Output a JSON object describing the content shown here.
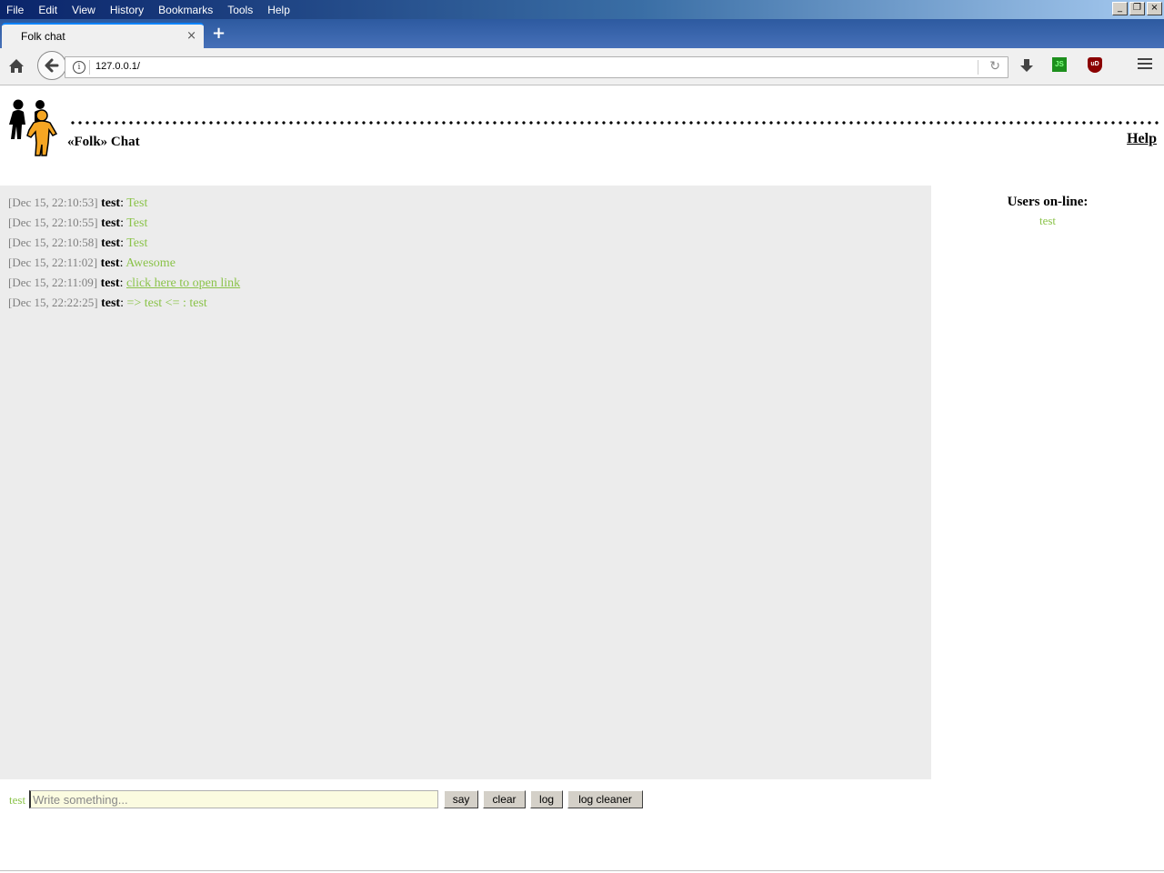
{
  "browser": {
    "menu": [
      "File",
      "Edit",
      "View",
      "History",
      "Bookmarks",
      "Tools",
      "Help"
    ],
    "menu_mnemonic": [
      "F",
      "E",
      "V",
      "s",
      "B",
      "T",
      "H"
    ],
    "tab_title": "Folk chat",
    "tab_close": "×",
    "new_tab": "+",
    "url": "127.0.0.1/",
    "window_controls": [
      "_",
      "❐",
      "×"
    ],
    "js_icon_text": "JS",
    "ublock_icon_text": "uD"
  },
  "header": {
    "app_title": "«Folk» Chat",
    "help_link": "Help"
  },
  "chat": {
    "messages": [
      {
        "time": "[Dec 15, 22:10:53]",
        "user": "test",
        "text": "Test",
        "is_link": false
      },
      {
        "time": "[Dec 15, 22:10:55]",
        "user": "test",
        "text": "Test",
        "is_link": false
      },
      {
        "time": "[Dec 15, 22:10:58]",
        "user": "test",
        "text": "Test",
        "is_link": false
      },
      {
        "time": "[Dec 15, 22:11:02]",
        "user": "test",
        "text": "Awesome",
        "is_link": false
      },
      {
        "time": "[Dec 15, 22:11:09]",
        "user": "test",
        "text": "click here to open link",
        "is_link": true
      },
      {
        "time": "[Dec 15, 22:22:25]",
        "user": "test",
        "text": "=> test <= : test",
        "is_link": false
      }
    ]
  },
  "users": {
    "title": "Users on-line:",
    "list": [
      "test"
    ]
  },
  "composer": {
    "nick": "test",
    "placeholder": "Write something...",
    "value": "",
    "buttons": {
      "say": "say",
      "clear": "clear",
      "log": "log",
      "log_cleaner": "log cleaner"
    }
  },
  "colors": {
    "accent_green": "#8bc34a",
    "chat_bg": "#ececec",
    "timestamp_gray": "#7f7f7f"
  }
}
